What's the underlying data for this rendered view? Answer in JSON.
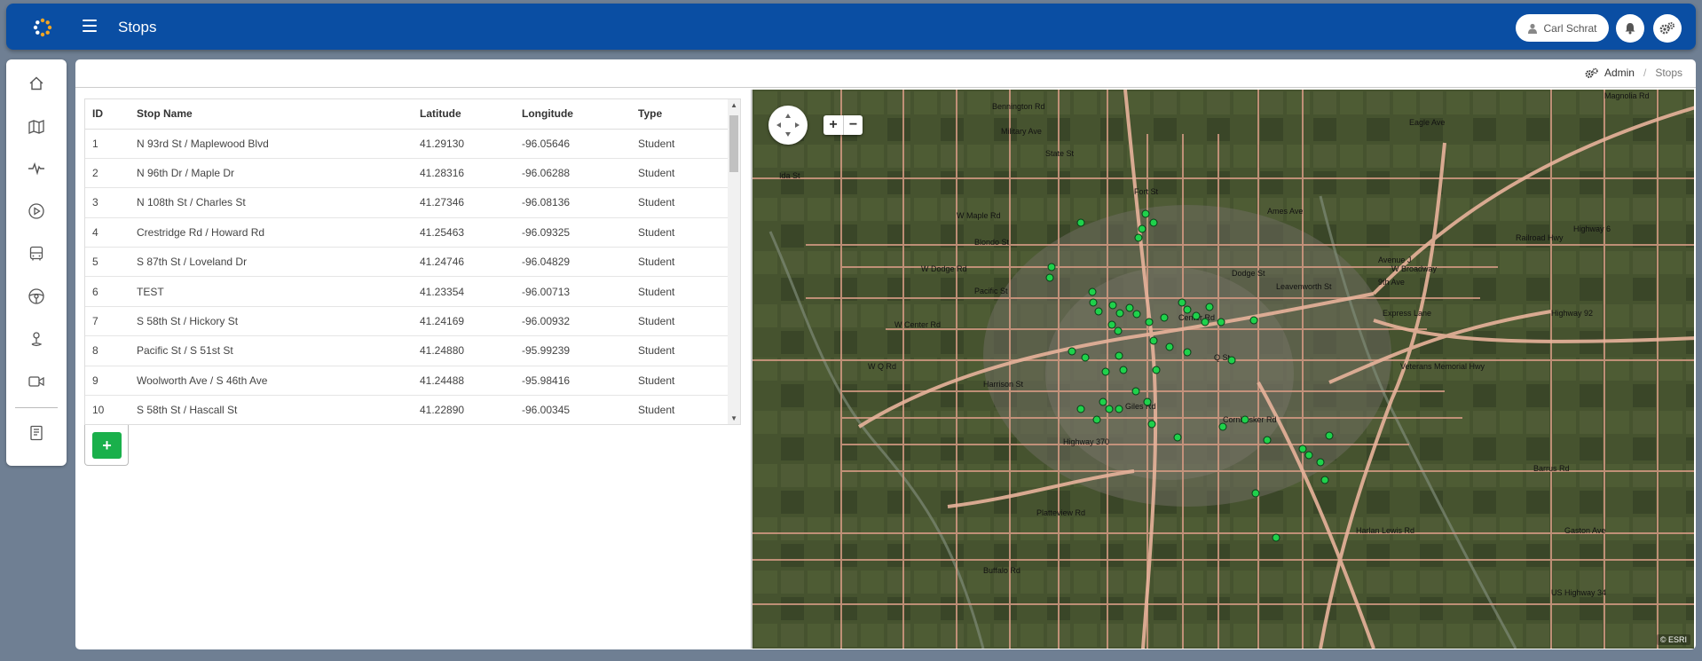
{
  "header": {
    "title": "Stops",
    "user_name": "Carl Schrat"
  },
  "breadcrumb": {
    "admin": "Admin",
    "current": "Stops"
  },
  "table": {
    "columns": [
      "ID",
      "Stop Name",
      "Latitude",
      "Longitude",
      "Type"
    ],
    "rows": [
      [
        "1",
        "N 93rd St / Maplewood Blvd",
        "41.29130",
        "-96.05646",
        "Student"
      ],
      [
        "2",
        "N 96th Dr / Maple Dr",
        "41.28316",
        "-96.06288",
        "Student"
      ],
      [
        "3",
        "N 108th St / Charles St",
        "41.27346",
        "-96.08136",
        "Student"
      ],
      [
        "4",
        "Crestridge Rd / Howard Rd",
        "41.25463",
        "-96.09325",
        "Student"
      ],
      [
        "5",
        "S 87th St / Loveland Dr",
        "41.24746",
        "-96.04829",
        "Student"
      ],
      [
        "6",
        "TEST",
        "41.23354",
        "-96.00713",
        "Student"
      ],
      [
        "7",
        "S 58th St / Hickory St",
        "41.24169",
        "-96.00932",
        "Student"
      ],
      [
        "8",
        "Pacific St / S 51st St",
        "41.24880",
        "-95.99239",
        "Student"
      ],
      [
        "9",
        "Woolworth Ave / S 46th Ave",
        "41.24488",
        "-95.98416",
        "Student"
      ],
      [
        "10",
        "S 58th St / Hascall St",
        "41.22890",
        "-96.00345",
        "Student"
      ]
    ]
  },
  "add_button": "+",
  "map": {
    "attribution": "© ESRI",
    "zoom_in": "+",
    "zoom_out": "−",
    "labels": [
      "Bennington Rd",
      "Military Ave",
      "State St",
      "Ida St",
      "W Maple Rd",
      "Blondo St",
      "W Dodge Rd",
      "Pacific St",
      "W Center Rd",
      "W Q Rd",
      "Harrison St",
      "Giles Rd",
      "Highway 370",
      "Platteview Rd",
      "Buffalo Rd",
      "Fort St",
      "Ames Ave",
      "Dodge St",
      "Leavenworth St",
      "Center Rd",
      "Q St",
      "Cornhusker Rd",
      "Avenue J",
      "W Broadway",
      "9th Ave",
      "Express Lane",
      "Highway 92",
      "Veterans Memorial Hwy",
      "Highway 6",
      "Railroad Hwy",
      "Gaston Ave",
      "Barrus Rd",
      "US Highway 34",
      "Harlan Lewis Rd",
      "Magnolia Rd",
      "Eagle Ave"
    ],
    "marker_color": "#1fd14b"
  },
  "colors": {
    "header_bg": "#0a4ea3",
    "add_button": "#1ab04b"
  }
}
